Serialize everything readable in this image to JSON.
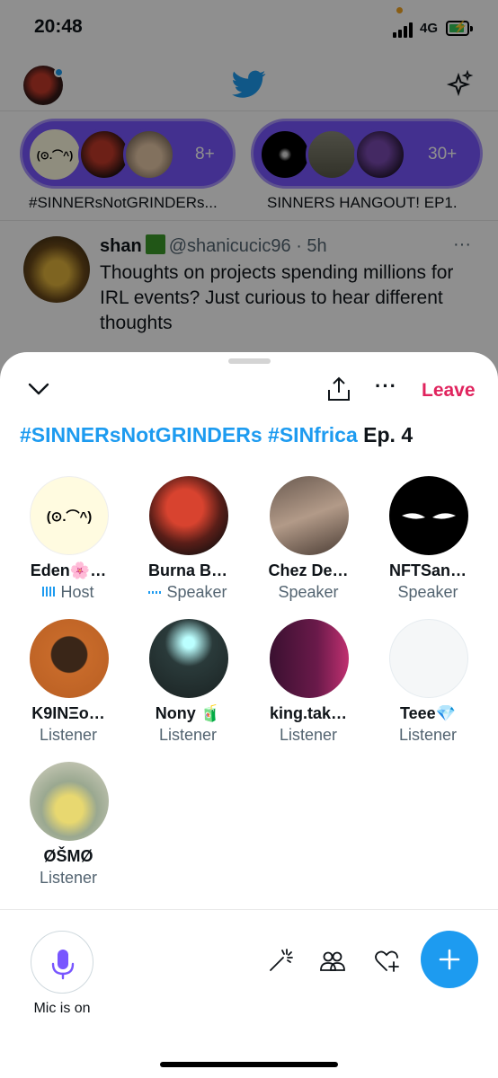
{
  "status_bar": {
    "time": "20:48",
    "network": "4G"
  },
  "fleets": [
    {
      "count": "8+",
      "title": "#SINNERsNotGRINDERs..."
    },
    {
      "count": "30+",
      "title": "SINNERS HANGOUT! EP1."
    }
  ],
  "tweet": {
    "name": "shan",
    "handle": "@shanicucic96",
    "time": "· 5h",
    "more": "···",
    "text": "Thoughts on projects spending millions for IRL events? Just curious to hear different thoughts"
  },
  "space": {
    "leave_label": "Leave",
    "more_label": "···",
    "title_tags": "#SINNERsNotGRINDERs #SINfrica",
    "title_rest": " Ep. 4",
    "participants": [
      {
        "name": "Eden🌸…",
        "role": "Host"
      },
      {
        "name": "Burna B…",
        "role": "Speaker"
      },
      {
        "name": "Chez De…",
        "role": "Speaker"
      },
      {
        "name": "NFTSan…",
        "role": "Speaker"
      },
      {
        "name": "K9INΞo…",
        "role": "Listener"
      },
      {
        "name": "Nony 🧃",
        "role": "Listener"
      },
      {
        "name": "king.tak…",
        "role": "Listener"
      },
      {
        "name": "Teee💎",
        "role": "Listener"
      },
      {
        "name": "ØŠMØ",
        "role": "Listener"
      }
    ],
    "face_glyph": "(⊙.⌒^)",
    "mic_label": "Mic is on"
  },
  "colors": {
    "accent": "#1d9bf0",
    "leave": "#e0245e",
    "space_purple": "#7856ff"
  }
}
